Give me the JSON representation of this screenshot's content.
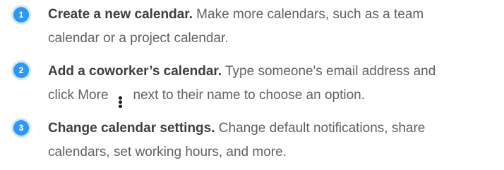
{
  "steps": [
    {
      "number": "1",
      "title": "Create a new calendar.",
      "line1": "Make more calendars, such as a team",
      "line2": "calendar or a project calendar."
    },
    {
      "number": "2",
      "title": "Add a coworker’s calendar.",
      "line1": "Type someone's email address and",
      "line2_before_icon": "click More",
      "line2_after_icon": "next to their name to choose an option.",
      "icon": "more-vert-icon"
    },
    {
      "number": "3",
      "title": "Change calendar settings.",
      "line1": "Change default notifications, share",
      "line2": "calendars, set working hours, and more."
    }
  ],
  "colors": {
    "badge": "#2f97f0",
    "title": "#3c4043",
    "body_text": "#5f6368"
  }
}
